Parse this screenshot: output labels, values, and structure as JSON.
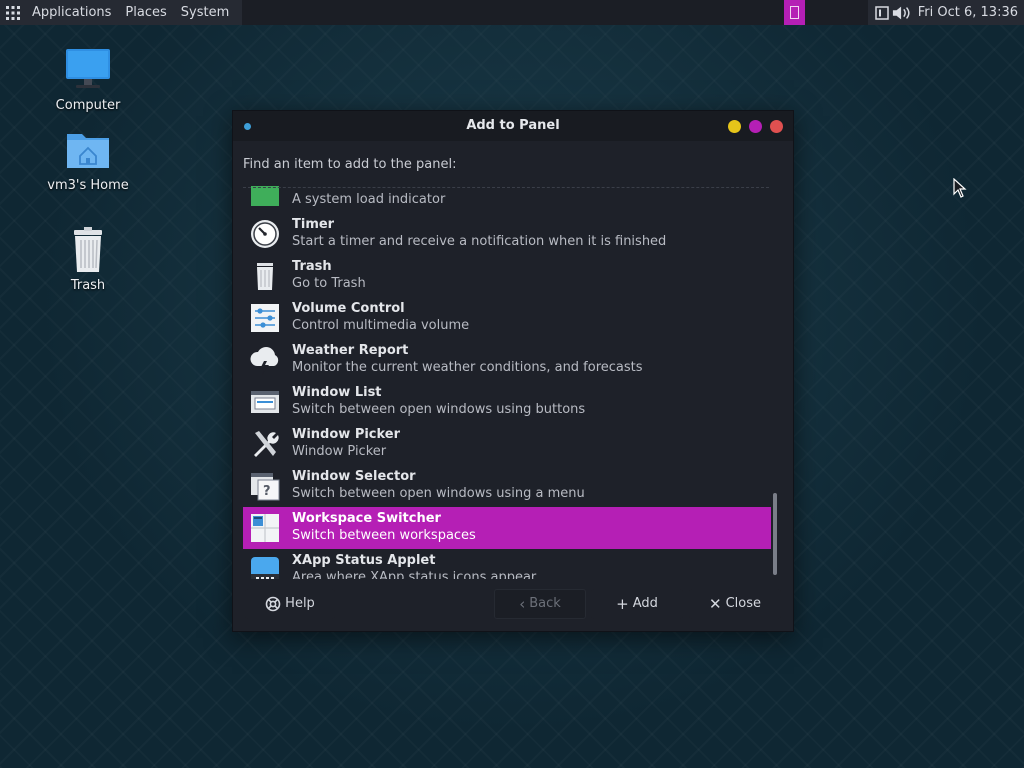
{
  "top_panel": {
    "menus": [
      "Applications",
      "Places",
      "System"
    ],
    "clock": "Fri Oct  6, 13:36",
    "icons": [
      "apps-grid-icon",
      "window-indicator-icon",
      "keyboard-indicator-icon",
      "volume-icon"
    ]
  },
  "desktop": {
    "icons": [
      {
        "label": "Computer",
        "icon": "computer-icon"
      },
      {
        "label": "vm3's Home",
        "icon": "home-folder-icon"
      },
      {
        "label": "Trash",
        "icon": "trash-icon"
      }
    ]
  },
  "dialog": {
    "title": "Add to Panel",
    "prompt": "Find an item to add to the panel:",
    "items": [
      {
        "name": "",
        "desc": "A system load indicator",
        "icon": "system-monitor-icon",
        "selected": false
      },
      {
        "name": "Timer",
        "desc": "Start a timer and receive a notification when it is finished",
        "icon": "timer-icon",
        "selected": false
      },
      {
        "name": "Trash",
        "desc": "Go to Trash",
        "icon": "trash-icon",
        "selected": false
      },
      {
        "name": "Volume Control",
        "desc": "Control multimedia volume",
        "icon": "volume-control-icon",
        "selected": false
      },
      {
        "name": "Weather Report",
        "desc": "Monitor the current weather conditions, and forecasts",
        "icon": "weather-icon",
        "selected": false
      },
      {
        "name": "Window List",
        "desc": "Switch between open windows using buttons",
        "icon": "window-list-icon",
        "selected": false
      },
      {
        "name": "Window Picker",
        "desc": "Window Picker",
        "icon": "tools-icon",
        "selected": false
      },
      {
        "name": "Window Selector",
        "desc": "Switch between open windows using a menu",
        "icon": "window-selector-icon",
        "selected": false
      },
      {
        "name": "Workspace Switcher",
        "desc": "Switch between workspaces",
        "icon": "workspace-switcher-icon",
        "selected": true
      },
      {
        "name": "XApp Status Applet",
        "desc": "Area where XApp status icons appear",
        "icon": "xapp-status-icon",
        "selected": false
      }
    ],
    "buttons": {
      "help": "Help",
      "back": "Back",
      "add": "Add",
      "close": "Close"
    }
  },
  "colors": {
    "accent": "#b51fb5",
    "panel": "#1b1e25",
    "dialog_bg": "#1e2129",
    "min_button": "#e6c51a",
    "close_button": "#e05050",
    "status_dot": "#3e9fd9"
  }
}
